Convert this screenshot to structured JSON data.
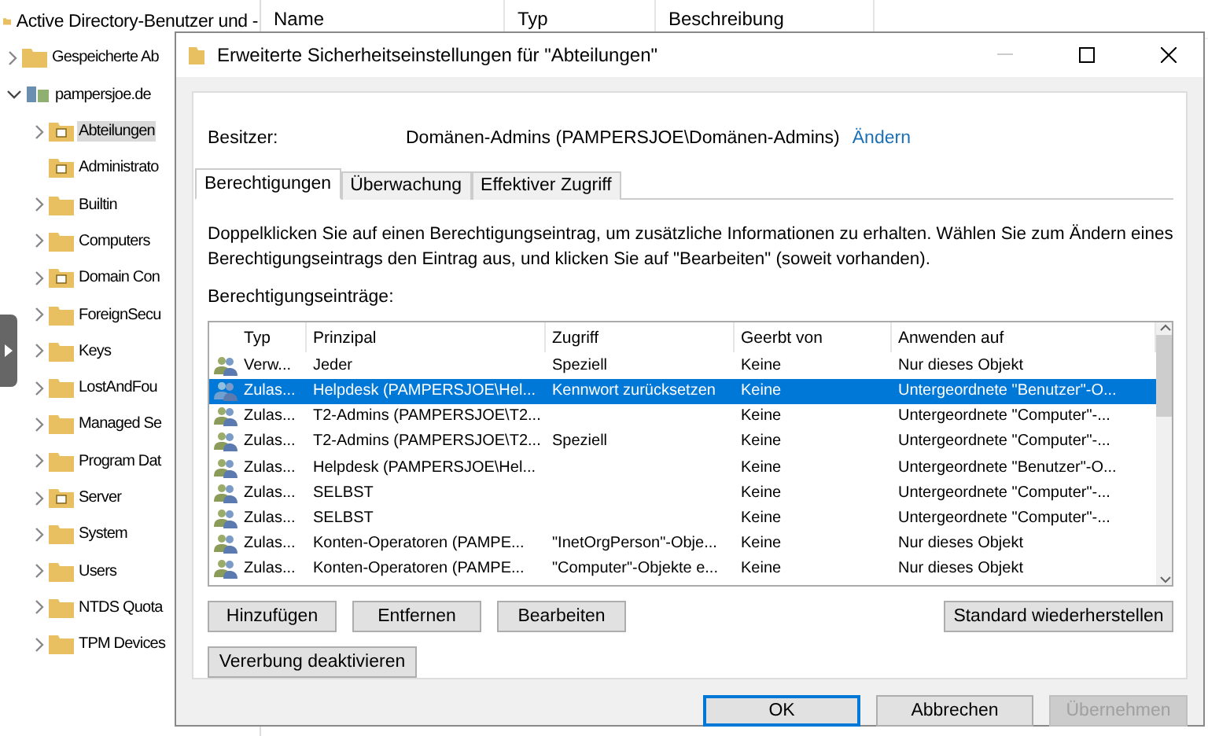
{
  "tree": {
    "label": "Active Directory-Benutzer und -",
    "children": [
      {
        "label": "Gespeicherte Ab",
        "kind": "folder",
        "expanded": false,
        "selected": false
      },
      {
        "label": "pampersjoe.de",
        "kind": "domain",
        "expanded": true,
        "selected": false,
        "children": [
          {
            "label": "Abteilungen",
            "kind": "ou",
            "expanded": false,
            "selected": true
          },
          {
            "label": "Administrato",
            "kind": "ou",
            "selected": false
          },
          {
            "label": "Builtin",
            "kind": "folder",
            "expanded": false,
            "selected": false
          },
          {
            "label": "Computers",
            "kind": "folder",
            "expanded": false,
            "selected": false
          },
          {
            "label": "Domain Con",
            "kind": "ou",
            "expanded": false,
            "selected": false
          },
          {
            "label": "ForeignSecu",
            "kind": "folder",
            "expanded": false,
            "selected": false
          },
          {
            "label": "Keys",
            "kind": "folder",
            "expanded": false,
            "selected": false
          },
          {
            "label": "LostAndFou",
            "kind": "folder",
            "expanded": false,
            "selected": false
          },
          {
            "label": "Managed Se",
            "kind": "folder",
            "expanded": false,
            "selected": false
          },
          {
            "label": "Program Dat",
            "kind": "folder",
            "expanded": false,
            "selected": false
          },
          {
            "label": "Server",
            "kind": "ou",
            "expanded": false,
            "selected": false
          },
          {
            "label": "System",
            "kind": "folder",
            "expanded": false,
            "selected": false
          },
          {
            "label": "Users",
            "kind": "folder",
            "expanded": false,
            "selected": false
          },
          {
            "label": "NTDS Quota",
            "kind": "folder",
            "expanded": false,
            "selected": false
          },
          {
            "label": "TPM Devices",
            "kind": "folder",
            "expanded": false,
            "selected": false
          }
        ]
      }
    ]
  },
  "list_columns": [
    "Name",
    "Typ",
    "Beschreibung"
  ],
  "dialog": {
    "title": "Erweiterte Sicherheitseinstellungen für \"Abteilungen\"",
    "owner_label": "Besitzer:",
    "owner_value": "Domänen-Admins (PAMPERSJOE\\Domänen-Admins)",
    "owner_link": "Ändern",
    "tabs": [
      {
        "label": "Berechtigungen",
        "selected": true
      },
      {
        "label": "Überwachung",
        "selected": false
      },
      {
        "label": "Effektiver Zugriff",
        "selected": false
      }
    ],
    "description": "Doppelklicken Sie auf einen Berechtigungseintrag, um zusätzliche Informationen zu erhalten. Wählen Sie zum Ändern eines Berechtigungseintrags den Eintrag aus, und klicken Sie auf \"Bearbeiten\" (soweit vorhanden).",
    "entries_label": "Berechtigungseinträge:",
    "columns": [
      "Typ",
      "Prinzipal",
      "Zugriff",
      "Geerbt von",
      "Anwenden auf"
    ],
    "rows": [
      {
        "type": "Verw...",
        "principal": "Jeder",
        "access": "Speziell",
        "inherited": "Keine",
        "applies": "Nur dieses Objekt",
        "selected": false
      },
      {
        "type": "Zulas...",
        "principal": "Helpdesk (PAMPERSJOE\\Hel...",
        "access": "Kennwort zurücksetzen",
        "inherited": "Keine",
        "applies": "Untergeordnete \"Benutzer\"-O...",
        "selected": true
      },
      {
        "type": "Zulas...",
        "principal": "T2-Admins (PAMPERSJOE\\T2...",
        "inherited": "Keine",
        "applies": "Untergeordnete \"Computer\"-...",
        "selected": false
      },
      {
        "type": "Zulas...",
        "principal": "T2-Admins (PAMPERSJOE\\T2...",
        "access": "Speziell",
        "inherited": "Keine",
        "applies": "Untergeordnete \"Computer\"-...",
        "selected": false
      },
      {
        "type": "Zulas...",
        "principal": "Helpdesk (PAMPERSJOE\\Hel...",
        "inherited": "Keine",
        "applies": "Untergeordnete \"Benutzer\"-O...",
        "selected": false
      },
      {
        "type": "Zulas...",
        "principal": "SELBST",
        "inherited": "Keine",
        "applies": "Untergeordnete \"Computer\"-...",
        "selected": false
      },
      {
        "type": "Zulas...",
        "principal": "SELBST",
        "inherited": "Keine",
        "applies": "Untergeordnete \"Computer\"-...",
        "selected": false
      },
      {
        "type": "Zulas...",
        "principal": "Konten-Operatoren (PAMPE...",
        "access": "\"InetOrgPerson\"-Obje...",
        "inherited": "Keine",
        "applies": "Nur dieses Objekt",
        "selected": false
      },
      {
        "type": "Zulas...",
        "principal": "Konten-Operatoren (PAMPE...",
        "access": "\"Computer\"-Objekte e...",
        "inherited": "Keine",
        "applies": "Nur dieses Objekt",
        "selected": false
      }
    ],
    "row_buttons": [
      "Hinzufügen",
      "Entfernen",
      "Bearbeiten"
    ],
    "restore_button": "Standard wiederherstellen",
    "inherit_button": "Vererbung deaktivieren",
    "footer_buttons": [
      {
        "label": "OK",
        "kind": "default"
      },
      {
        "label": "Abbrechen",
        "kind": "normal"
      },
      {
        "label": "Übernehmen",
        "kind": "disabled"
      }
    ]
  }
}
